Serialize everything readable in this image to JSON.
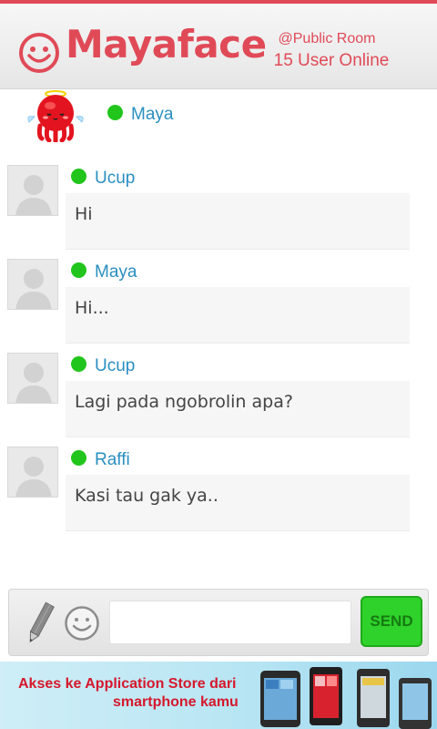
{
  "header": {
    "app_name": "Mayaface",
    "room": "@Public Room",
    "online_count": "15 User Online",
    "brand_color": "#e04a57",
    "logo_icon": "smiley-face-icon"
  },
  "current_user": {
    "name": "Maya",
    "status": "online",
    "avatar_icon": "red-octopus-mascot-icon"
  },
  "messages": [
    {
      "sender": "Ucup",
      "text": "Hi",
      "status": "online",
      "avatar_icon": "default-user-avatar-icon"
    },
    {
      "sender": "Maya",
      "text": "Hi...",
      "status": "online",
      "avatar_icon": "default-user-avatar-icon"
    },
    {
      "sender": "Ucup",
      "text": "Lagi pada ngobrolin apa?",
      "status": "online",
      "avatar_icon": "default-user-avatar-icon"
    },
    {
      "sender": "Raffi",
      "text": "Kasi tau gak ya..",
      "status": "online",
      "avatar_icon": "default-user-avatar-icon"
    }
  ],
  "composer": {
    "input_value": "",
    "input_placeholder": "",
    "send_label": "SEND",
    "pencil_icon": "pencil-icon",
    "emoji_icon": "smiley-emoji-icon",
    "send_color": "#2fd22a"
  },
  "banner": {
    "line1": "Akses ke Application Store dari",
    "line2": "smartphone kamu",
    "text_color": "#d6172c"
  },
  "status_color": "#22c51c"
}
